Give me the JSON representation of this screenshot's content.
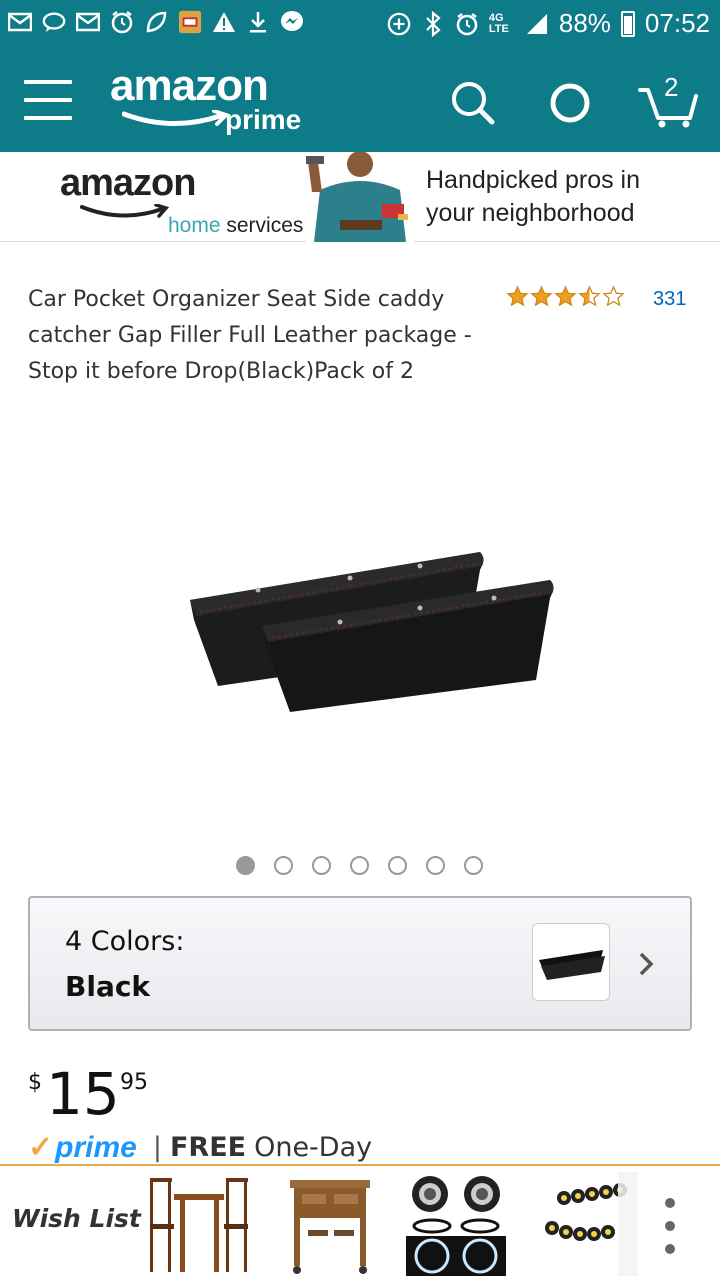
{
  "status_bar": {
    "network": "4G LTE",
    "battery": "88%",
    "time": "07:52"
  },
  "header": {
    "logo_text": "amazon",
    "logo_sub": "prime",
    "cart_count": "2",
    "icons": [
      "menu-icon",
      "search-icon",
      "alexa-icon",
      "cart-icon"
    ],
    "color": "#0e7b89"
  },
  "banner": {
    "logo_text": "amazon",
    "logo_sub_a": "home",
    "logo_sub_b": " services",
    "tagline_line1": "Handpicked pros in",
    "tagline_line2": "your neighborhood"
  },
  "product": {
    "title": "Car Pocket Organizer Seat Side caddy catcher Gap Filler Full Leather package - Stop it before Drop(Black)Pack of 2",
    "rating": 3.5,
    "rating_max": 5,
    "review_count": "331",
    "image_count": 7,
    "image_index": 1
  },
  "variation": {
    "label": "4 Colors:",
    "value": "Black"
  },
  "price": {
    "symbol": "$",
    "whole": "15",
    "fraction": "95"
  },
  "shipping": {
    "prime_label": "prime",
    "separator": "|",
    "free": "FREE",
    "speed": "One-Day"
  },
  "bottom_bar": {
    "label": "Wish List",
    "thumbnails": [
      "bar-table-set",
      "kitchen-cart-with-stools",
      "projector-headlight-rings",
      "led-eagle-eye-lights"
    ]
  }
}
